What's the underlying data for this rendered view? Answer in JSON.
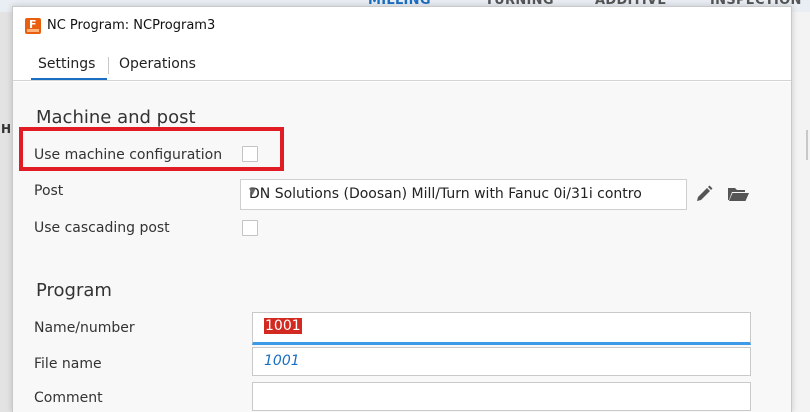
{
  "background": {
    "tabs": [
      "MILLING",
      "TURNING",
      "ADDITIVE",
      "INSPECTION"
    ],
    "left_letter": "H"
  },
  "dialog": {
    "title": "NC Program: NCProgram3",
    "icon": "fusion-app-icon",
    "icon_letter": "F"
  },
  "tabs": [
    {
      "label": "Settings",
      "active": true
    },
    {
      "label": "Operations",
      "active": false
    }
  ],
  "machine_and_post": {
    "heading": "Machine and post",
    "use_machine_configuration": {
      "label": "Use machine configuration",
      "checked": false
    },
    "post": {
      "label": "Post",
      "value": "DN Solutions (Doosan) Mill/Turn with Fanuc 0i/31i contro",
      "edit_icon": "pencil-icon",
      "open_icon": "folder-open-icon"
    },
    "use_cascading_post": {
      "label": "Use cascading post",
      "checked": false
    }
  },
  "program": {
    "heading": "Program",
    "name_number": {
      "label": "Name/number",
      "value": "1001"
    },
    "file_name": {
      "label": "File name",
      "value": "1001"
    },
    "comment": {
      "label": "Comment",
      "value": ""
    }
  },
  "colors": {
    "accent": "#1a6fc2",
    "highlight_box": "#e11c24",
    "text_selection": "#d22a20"
  }
}
